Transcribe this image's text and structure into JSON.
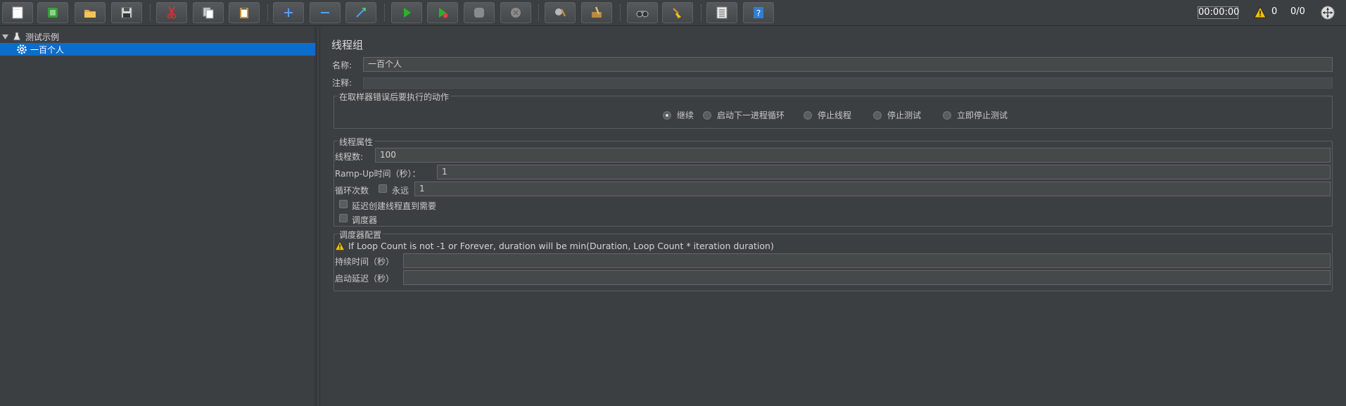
{
  "toolbar": {
    "buttons": [
      {
        "name": "new-button",
        "icon": "new-document-icon"
      },
      {
        "name": "templates-button",
        "icon": "templates-icon"
      },
      {
        "name": "open-button",
        "icon": "open-folder-icon"
      },
      {
        "name": "save-button",
        "icon": "floppy-disk-icon"
      },
      {
        "name": "cut-button",
        "icon": "scissors-icon"
      },
      {
        "name": "copy-button",
        "icon": "copy-icon"
      },
      {
        "name": "paste-button",
        "icon": "clipboard-icon"
      },
      {
        "name": "expand-button",
        "icon": "plus-icon"
      },
      {
        "name": "collapse-button",
        "icon": "minus-icon"
      },
      {
        "name": "toggle-button",
        "icon": "wand-icon"
      },
      {
        "name": "start-button",
        "icon": "play-icon"
      },
      {
        "name": "start-no-pauses-button",
        "icon": "play-timer-icon"
      },
      {
        "name": "stop-button",
        "icon": "stop-icon"
      },
      {
        "name": "shutdown-button",
        "icon": "shutdown-icon"
      },
      {
        "name": "clear-button",
        "icon": "broom-gear-icon"
      },
      {
        "name": "clear-all-button",
        "icon": "broom-box-icon"
      },
      {
        "name": "search-button",
        "icon": "binoculars-icon"
      },
      {
        "name": "reset-search-button",
        "icon": "broom-icon"
      },
      {
        "name": "function-helper-button",
        "icon": "list-icon"
      },
      {
        "name": "help-button",
        "icon": "help-book-icon"
      }
    ],
    "timer": "00:00:00",
    "warning_count": "0",
    "threads": "0/0",
    "colors": {
      "play": "#27b427",
      "accent": "#0d6dca",
      "warning": "#f2c100"
    }
  },
  "tree": {
    "root_label": "测试示例",
    "child_label": "一百个人"
  },
  "panel": {
    "title": "线程组",
    "name_label": "名称:",
    "name_value": "一百个人",
    "comment_label": "注释:",
    "comment_value": "",
    "error_action": {
      "legend": "在取样器错误后要执行的动作",
      "options": [
        "继续",
        "启动下一进程循环",
        "停止线程",
        "停止测试",
        "立即停止测试"
      ],
      "selected": "继续"
    },
    "thread_props": {
      "legend": "线程属性",
      "threads_label": "线程数:",
      "threads_value": "100",
      "rampup_label": "Ramp-Up时间（秒）：",
      "rampup_value": "1",
      "loop_label": "循环次数",
      "forever_label": "永远",
      "loop_value": "1",
      "delay_label": "延迟创建线程直到需要",
      "scheduler_label": "调度器"
    },
    "scheduler_config": {
      "legend": "调度器配置",
      "warning": "If Loop Count is not -1 or Forever, duration will be min(Duration, Loop Count * iteration duration)",
      "duration_label": "持续时间（秒）",
      "duration_value": "",
      "startup_delay_label": "启动延迟（秒）",
      "startup_delay_value": ""
    }
  }
}
